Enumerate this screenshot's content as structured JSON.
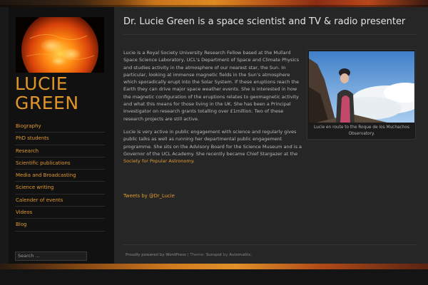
{
  "site": {
    "title_line1": "LUCIE",
    "title_line2": "GREEN",
    "logo_alt": "sun-image"
  },
  "nav": {
    "items": [
      {
        "label": "Biography"
      },
      {
        "label": "PhD students"
      },
      {
        "label": "Research"
      },
      {
        "label": "Scientific publications"
      },
      {
        "label": "Media and Broadcasting"
      },
      {
        "label": "Science writing"
      },
      {
        "label": "Calender of events"
      },
      {
        "label": "Videos"
      },
      {
        "label": "Blog"
      }
    ]
  },
  "search": {
    "placeholder": "Search ..."
  },
  "page": {
    "title": "Dr. Lucie Green is a space scientist and TV & radio presenter",
    "paragraph1": "Lucie is  a Royal Society University Research Fellow based at the Mullard Space Science Laboratory, UCL’s Department of Space and Climate Physics and studies activity in the atmosphere of our nearest star, the Sun. In particular, looking at immense magnetic fields in the Sun’s atmosphere which sporadically erupt into the Solar System. If these eruptions reach the Earth they can drive major space weather events. She is interested in how the magnetic configuration of the eruptions relates to geomagnetic activity and what this means for those living in the UK. She has been a Principal Investigator on research grants totalling over £1million. Two of these research projects are still active.",
    "paragraph2_start": "Lucie is very active in public engagement with science and regularly gives public talks as well as running her departmental public engagement programme. She sits on the Advisory Board for the Science Museum and is a Governor of the UCL Academy. She recently became Chief Stargazer at the ",
    "paragraph2_link": "Society for Popular Astronomy",
    "paragraph2_end": ".",
    "figure_caption": "Lucie en route to the Roque de los Muchachos Observatory.",
    "tweets_link": "Tweets by @Dr_Lucie"
  },
  "footer": {
    "powered": "Proudly powered by WordPress",
    "separator": " | ",
    "theme_label": "Theme: ",
    "theme_name": "Sunspot",
    "by": " by ",
    "author": "Automattic",
    "end": "."
  },
  "colors": {
    "accent": "#e09a30",
    "background": "#191919",
    "content_bg": "#262626",
    "sidebar_bg": "#111111"
  }
}
